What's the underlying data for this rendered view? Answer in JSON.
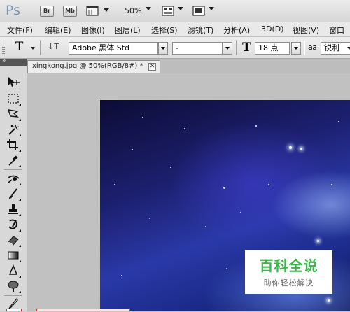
{
  "app": {
    "logo": "Ps",
    "bridge_label": "Br",
    "minibridge_label": "Mb",
    "zoom": "50%"
  },
  "menu": [
    "文件(F)",
    "编辑(E)",
    "图像(I)",
    "图层(L)",
    "选择(S)",
    "滤镜(T)",
    "分析(A)",
    "3D(D)",
    "视图(V)",
    "窗口"
  ],
  "options": {
    "tool_glyph": "T",
    "orientation_glyph": "↓T",
    "font_family": "Adobe 黑体 Std",
    "font_style": "-",
    "size_glyph": "T",
    "font_size": "18 点",
    "aa_glyph": "a a",
    "antialias": "锐利"
  },
  "panel": {
    "collapse_glyph": "»"
  },
  "document": {
    "tab_label": "xingkong.jpg @ 50%(RGB/8#) *",
    "close_glyph": "✕"
  },
  "watermark": {
    "title": "百科全说",
    "subtitle": "助你轻松解决"
  },
  "colors": {
    "watermark_green": "#3bb54a",
    "canvas_deep_blue": "#1c1f6e"
  },
  "tools": [
    "move-tool",
    "marquee-tool",
    "lasso-tool",
    "quick-selection-tool",
    "crop-tool",
    "eyedropper-tool",
    "spot-healing-tool",
    "brush-tool",
    "clone-stamp-tool",
    "history-brush-tool",
    "eraser-tool",
    "gradient-tool",
    "blur-tool",
    "dodge-tool",
    "pen-tool",
    "type-tool"
  ]
}
